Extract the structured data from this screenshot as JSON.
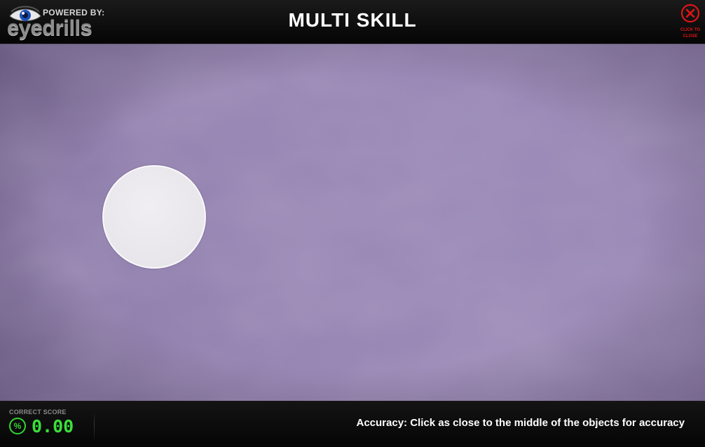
{
  "header": {
    "powered_by": "POWERED BY:",
    "brand": "eyedrills",
    "title": "MULTI SKILL",
    "close_label": "CLICK TO CLOSE",
    "close_icon": "close-circle-icon",
    "logo_icon": "eye-icon"
  },
  "game": {
    "target_shape": "circle",
    "target_count": 1
  },
  "footer": {
    "score_label": "CORRECT SCORE",
    "score_icon": "percent-icon",
    "score_symbol": "%",
    "score_value": "0.00",
    "instruction": "Accuracy: Click as close to the middle of the objects for accuracy"
  },
  "colors": {
    "background": "#9685b3",
    "score_green": "#3ae03a",
    "close_red": "#e01515"
  }
}
